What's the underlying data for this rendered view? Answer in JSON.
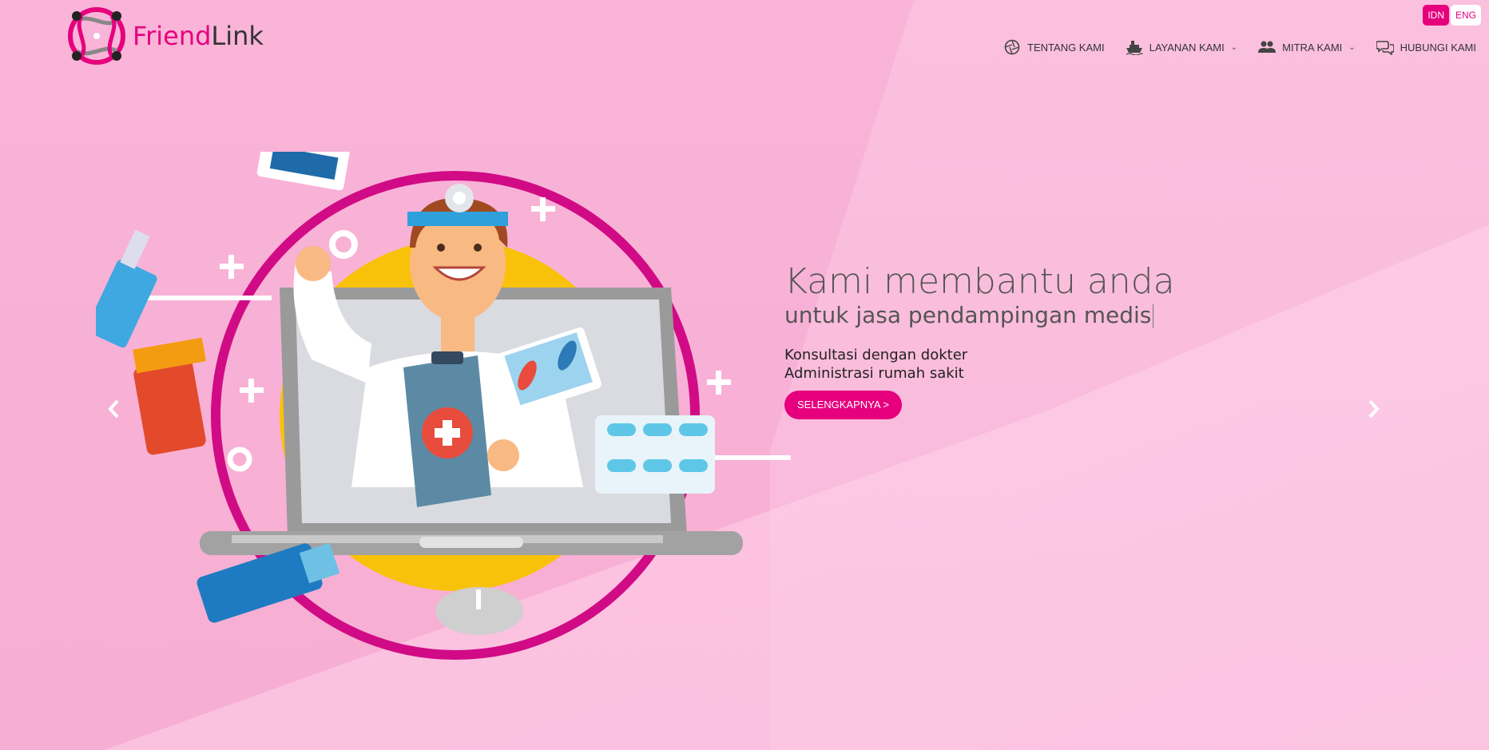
{
  "brand": {
    "name_part1": "Friend",
    "name_part2": "Link",
    "accent_color": "#e6007e"
  },
  "language": {
    "options": [
      "IDN",
      "ENG"
    ],
    "selected": "IDN"
  },
  "nav": {
    "items": [
      {
        "label": "TENTANG KAMI",
        "icon": "aperture-icon",
        "has_dropdown": false
      },
      {
        "label": "LAYANAN KAMI",
        "icon": "ship-icon",
        "has_dropdown": true
      },
      {
        "label": "MITRA KAMI",
        "icon": "people-icon",
        "has_dropdown": true
      },
      {
        "label": "HUBUNGI KAMI",
        "icon": "chat-bubbles-icon",
        "has_dropdown": false
      }
    ]
  },
  "hero": {
    "title": "Kami membantu anda",
    "subtitle": "untuk jasa pendampingan medis",
    "list": [
      "Konsultasi dengan dokter",
      "Administrasi rumah sakit"
    ],
    "cta_label": "SELENGKAPNYA >"
  },
  "carousel": {
    "prev_icon": "chevron-left-icon",
    "next_icon": "chevron-right-icon"
  }
}
